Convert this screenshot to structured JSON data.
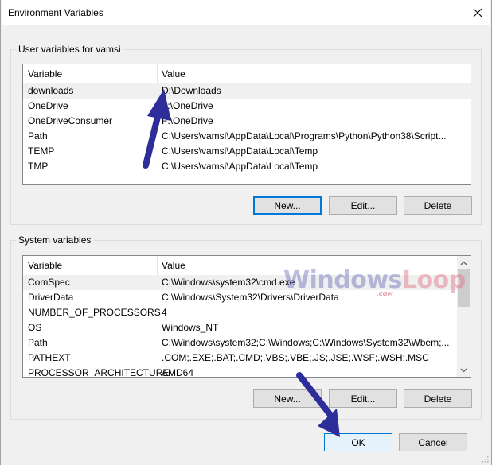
{
  "window": {
    "title": "Environment Variables",
    "close_icon": "close-icon"
  },
  "user_vars": {
    "group_label": "User variables for vamsi",
    "columns": [
      "Variable",
      "Value"
    ],
    "rows": [
      {
        "variable": "downloads",
        "value": "D:\\Downloads",
        "selected": true
      },
      {
        "variable": "OneDrive",
        "value": "F:\\OneDrive",
        "selected": false
      },
      {
        "variable": "OneDriveConsumer",
        "value": "F:\\OneDrive",
        "selected": false
      },
      {
        "variable": "Path",
        "value": "C:\\Users\\vamsi\\AppData\\Local\\Programs\\Python\\Python38\\Script...",
        "selected": false
      },
      {
        "variable": "TEMP",
        "value": "C:\\Users\\vamsi\\AppData\\Local\\Temp",
        "selected": false
      },
      {
        "variable": "TMP",
        "value": "C:\\Users\\vamsi\\AppData\\Local\\Temp",
        "selected": false
      }
    ],
    "buttons": {
      "new": "New...",
      "edit": "Edit...",
      "delete": "Delete"
    }
  },
  "system_vars": {
    "group_label": "System variables",
    "columns": [
      "Variable",
      "Value"
    ],
    "rows": [
      {
        "variable": "ComSpec",
        "value": "C:\\Windows\\system32\\cmd.exe",
        "selected": true
      },
      {
        "variable": "DriverData",
        "value": "C:\\Windows\\System32\\Drivers\\DriverData",
        "selected": false
      },
      {
        "variable": "NUMBER_OF_PROCESSORS",
        "value": "4",
        "selected": false
      },
      {
        "variable": "OS",
        "value": "Windows_NT",
        "selected": false
      },
      {
        "variable": "Path",
        "value": "C:\\Windows\\system32;C:\\Windows;C:\\Windows\\System32\\Wbem;...",
        "selected": false
      },
      {
        "variable": "PATHEXT",
        "value": ".COM;.EXE;.BAT;.CMD;.VBS;.VBE;.JS;.JSE;.WSF;.WSH;.MSC",
        "selected": false
      },
      {
        "variable": "PROCESSOR_ARCHITECTURE",
        "value": "AMD64",
        "selected": false
      }
    ],
    "buttons": {
      "new": "New...",
      "edit": "Edit...",
      "delete": "Delete"
    }
  },
  "footer": {
    "ok": "OK",
    "cancel": "Cancel"
  },
  "watermark": {
    "text_main": "Windows",
    "text_loop": "Loop",
    "text_com": ".COM"
  },
  "annotation_color": "#2e2e9a"
}
